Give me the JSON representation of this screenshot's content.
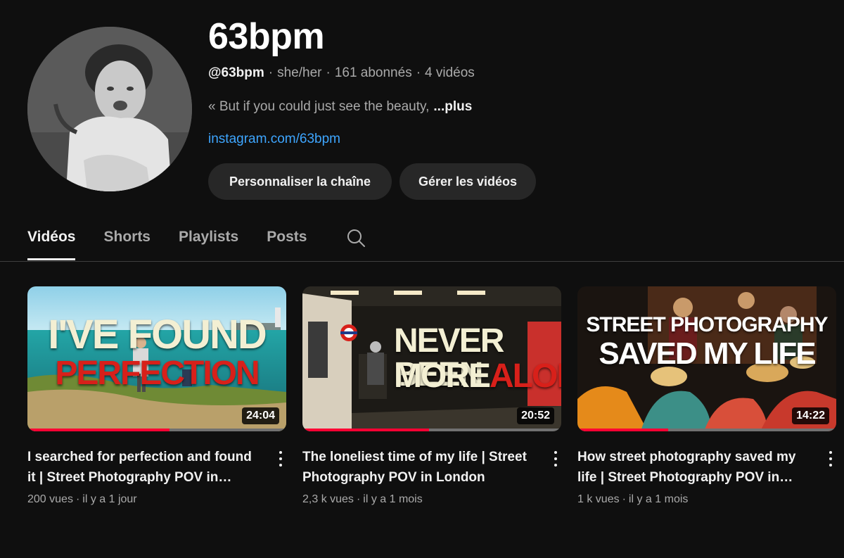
{
  "channel": {
    "title": "63bpm",
    "handle": "@63bpm",
    "pronouns": "she/her",
    "subscribers": "161 abonnés",
    "video_count": "4 vidéos",
    "separator": "·",
    "description": "« But if you could just see the beauty,",
    "more_label": "...plus",
    "link": "instagram.com/63bpm"
  },
  "buttons": {
    "customize": "Personnaliser la chaîne",
    "manage": "Gérer les vidéos"
  },
  "tabs": [
    {
      "label": "Vidéos",
      "active": true
    },
    {
      "label": "Shorts",
      "active": false
    },
    {
      "label": "Playlists",
      "active": false
    },
    {
      "label": "Posts",
      "active": false
    }
  ],
  "videos": [
    {
      "thumb_line1": "I'VE FOUND",
      "thumb_line2": "PERFECTION",
      "duration": "24:04",
      "progress": 0.55,
      "title": "I searched for perfection and found it | Street Photography POV in…",
      "views": "200 vues",
      "age": "il y a 1 jour"
    },
    {
      "thumb_line1": "NEVER BEEN",
      "thumb_line2a": "MORE",
      "thumb_line2b": "ALONE",
      "duration": "20:52",
      "progress": 0.49,
      "title": "The loneliest time of my life | Street Photography POV in London",
      "views": "2,3 k vues",
      "age": "il y a 1 mois"
    },
    {
      "thumb_line1": "STREET PHOTOGRAPHY",
      "thumb_line2": "SAVED MY LIFE",
      "duration": "14:22",
      "progress": 0.35,
      "title": "How street photography saved my life | Street Photography POV in…",
      "views": "1 k vues",
      "age": "il y a 1 mois"
    }
  ],
  "colors": {
    "background": "#0f0f0f",
    "link": "#3ea6ff",
    "progress": "#ff0033",
    "button": "#272727"
  }
}
